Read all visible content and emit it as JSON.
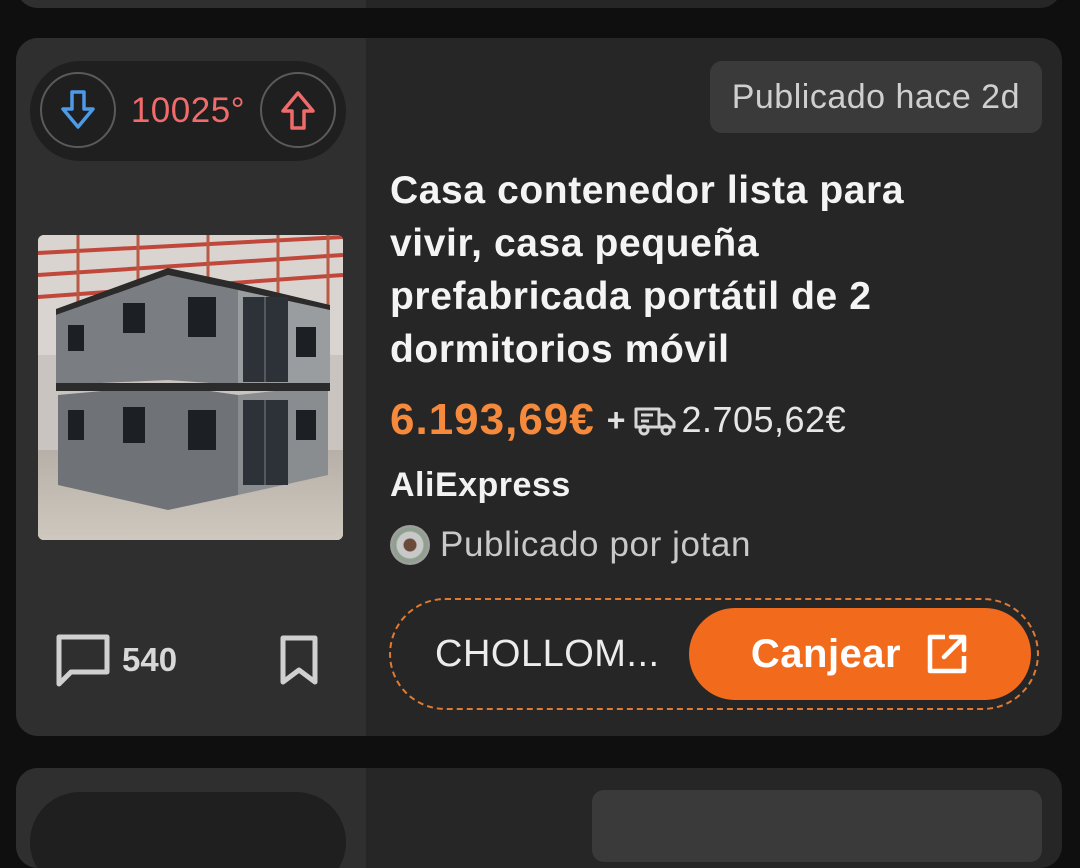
{
  "deal": {
    "temperature": "10025°",
    "posted_ago": "Publicado hace 2d",
    "title": "Casa contenedor lista para vivir, casa pequeña prefabricada portátil de 2 dormitorios móvil",
    "price": "6.193,69€",
    "plus": "+",
    "shipping_cost": "2.705,62€",
    "merchant": "AliExpress",
    "posted_by": "Publicado por jotan",
    "comments_count": "540",
    "coupon_code": "CHOLLOM...",
    "redeem_label": "Canjear"
  },
  "colors": {
    "price": "#f58a3c",
    "temperature": "#f06b6b",
    "redeem_button": "#f26b1d",
    "vote_down_arrow": "#4d9ae8",
    "vote_up_arrow": "#ef6b6b"
  },
  "icons": {
    "vote_down": "arrow-down-icon",
    "vote_up": "arrow-up-icon",
    "shipping": "truck-icon",
    "comments": "comment-icon",
    "bookmark": "bookmark-icon",
    "redeem": "external-link-icon"
  }
}
